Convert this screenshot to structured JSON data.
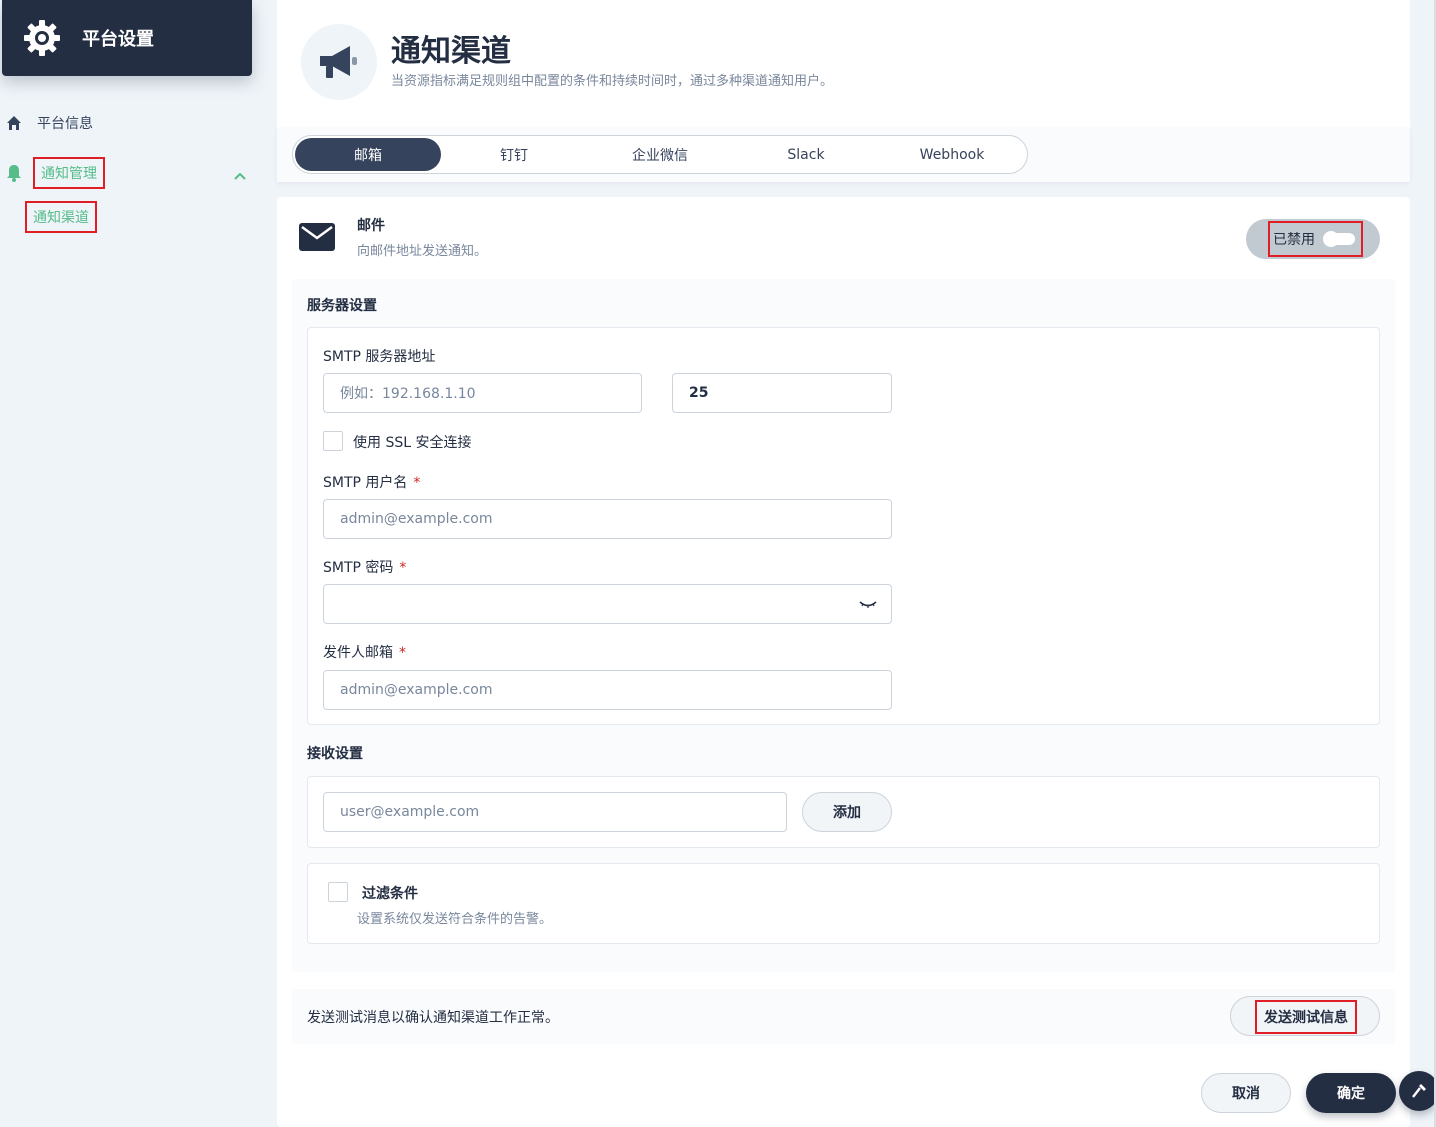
{
  "sidebar": {
    "title": "平台设置",
    "items": [
      {
        "label": "平台信息",
        "icon": "home-icon"
      },
      {
        "label": "通知管理",
        "icon": "bell-icon",
        "expanded": true
      },
      {
        "label": "通知渠道"
      }
    ]
  },
  "header": {
    "title": "通知渠道",
    "description": "当资源指标满足规则组中配置的条件和持续时间时，通过多种渠道通知用户。"
  },
  "tabs": [
    {
      "label": "邮箱",
      "active": true
    },
    {
      "label": "钉钉"
    },
    {
      "label": "企业微信"
    },
    {
      "label": "Slack"
    },
    {
      "label": "Webhook"
    }
  ],
  "channel": {
    "title": "邮件",
    "subtitle": "向邮件地址发送通知。",
    "status": "已禁用"
  },
  "server": {
    "section": "服务器设置",
    "smtp_address_label": "SMTP 服务器地址",
    "smtp_address_placeholder": "例如：192.168.1.10",
    "port_value": "25",
    "ssl_label": "使用 SSL 安全连接",
    "username_label": "SMTP 用户名",
    "username_placeholder": "admin@example.com",
    "password_label": "SMTP 密码",
    "sender_label": "发件人邮箱",
    "sender_placeholder": "admin@example.com",
    "required_mark": "*"
  },
  "receive": {
    "section": "接收设置",
    "email_placeholder": "user@example.com",
    "add_label": "添加"
  },
  "filter": {
    "title": "过滤条件",
    "description": "设置系统仅发送符合条件的告警。"
  },
  "test": {
    "text": "发送测试消息以确认通知渠道工作正常。",
    "button": "发送测试信息"
  },
  "footer": {
    "cancel": "取消",
    "confirm": "确定"
  },
  "colors": {
    "dark": "#242e42",
    "accent_green": "#55bc8a",
    "highlight_red": "#e01e26",
    "bg": "#eff4f9"
  }
}
